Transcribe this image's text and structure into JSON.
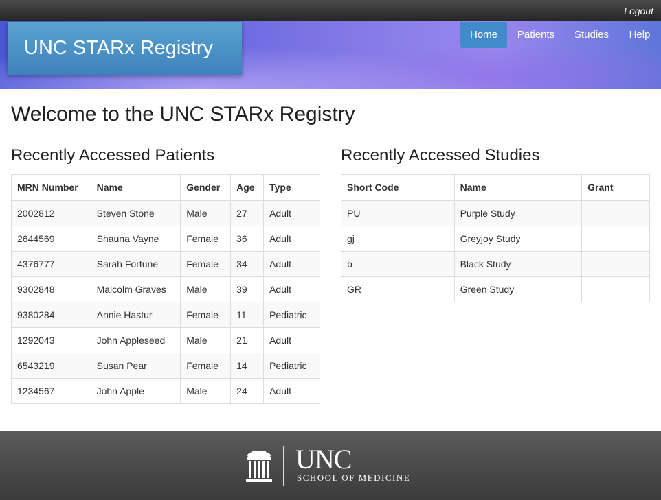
{
  "topbar": {
    "logout": "Logout"
  },
  "header": {
    "title": "UNC STARx Registry",
    "nav": [
      {
        "label": "Home",
        "active": true
      },
      {
        "label": "Patients"
      },
      {
        "label": "Studies"
      },
      {
        "label": "Help"
      }
    ]
  },
  "main": {
    "heading": "Welcome to the UNC STARx Registry",
    "patients": {
      "heading": "Recently Accessed Patients",
      "columns": [
        "MRN Number",
        "Name",
        "Gender",
        "Age",
        "Type"
      ],
      "rows": [
        [
          "2002812",
          "Steven Stone",
          "Male",
          "27",
          "Adult"
        ],
        [
          "2644569",
          "Shauna Vayne",
          "Female",
          "36",
          "Adult"
        ],
        [
          "4376777",
          "Sarah Fortune",
          "Female",
          "34",
          "Adult"
        ],
        [
          "9302848",
          "Malcolm Graves",
          "Male",
          "39",
          "Adult"
        ],
        [
          "9380284",
          "Annie Hastur",
          "Female",
          "11",
          "Pediatric"
        ],
        [
          "1292043",
          "John Appleseed",
          "Male",
          "21",
          "Adult"
        ],
        [
          "6543219",
          "Susan Pear",
          "Female",
          "14",
          "Pediatric"
        ],
        [
          "1234567",
          "John Apple",
          "Male",
          "24",
          "Adult"
        ]
      ]
    },
    "studies": {
      "heading": "Recently Accessed Studies",
      "columns": [
        "Short Code",
        "Name",
        "Grant"
      ],
      "rows": [
        [
          "PU",
          "Purple Study",
          ""
        ],
        [
          "gj",
          "Greyjoy Study",
          ""
        ],
        [
          "b",
          "Black Study",
          ""
        ],
        [
          "GR",
          "Green Study",
          ""
        ]
      ]
    }
  },
  "footer": {
    "logo_main": "UNC",
    "logo_sub": "SCHOOL OF MEDICINE",
    "logo_icon": "old-well-icon"
  },
  "colors": {
    "accent": "#428bca",
    "title_box": "#4a93c6"
  }
}
